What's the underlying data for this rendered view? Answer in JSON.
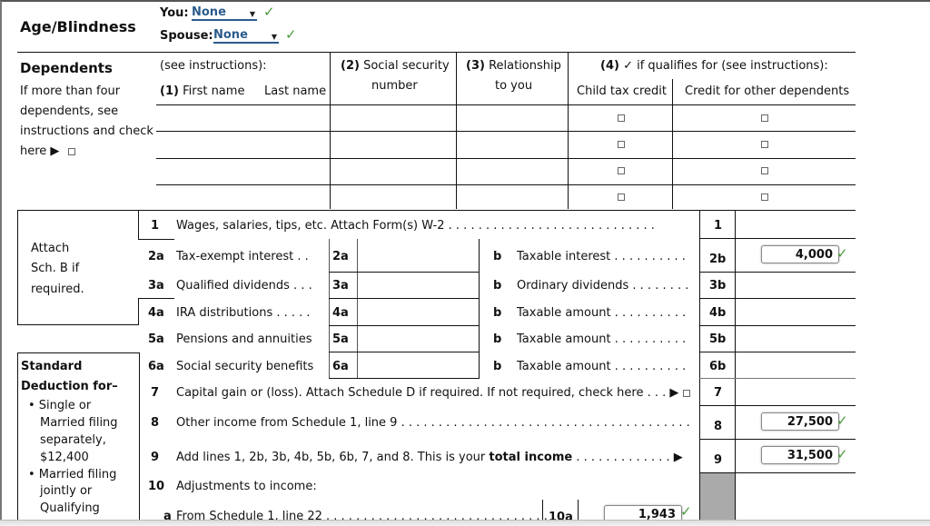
{
  "age_blindness": {
    "title": "Age/Blindness",
    "you_label": "You:",
    "you_value": "None",
    "spouse_label": "Spouse:",
    "spouse_value": "None"
  },
  "dependents": {
    "title": "Dependents",
    "note_lines": [
      "If more than four",
      "dependents, see",
      "instructions and check",
      "here ▶"
    ],
    "see_instructions": "(see instructions):",
    "col1_num": "(1)",
    "col1_first": "First name",
    "col1_last": "Last name",
    "col2_num": "(2)",
    "col2_line1": "Social security",
    "col2_line2": "number",
    "col3_num": "(3)",
    "col3_line1": "Relationship",
    "col3_line2": "to you",
    "col4_num": "(4)",
    "col4_text": "✓ if qualifies for (see instructions):",
    "col4a": "Child tax credit",
    "col4b": "Credit for other dependents",
    "rows": 4
  },
  "attach": {
    "lines": [
      "Attach",
      "Sch. B if",
      "required."
    ]
  },
  "std_deduction": {
    "title_line1": "Standard",
    "title_line2": "Deduction for–",
    "items": [
      "• Single or",
      "Married filing",
      "separately,",
      "$12,400",
      "• Married filing",
      "jointly or",
      "Qualifying"
    ]
  },
  "income_lines": {
    "line1": {
      "num": "1",
      "label": "Wages, salaries, tips, etc. Attach Form(s) W-2 . . . . . . . . . . . . . . . . . . . . . . . . . . . .",
      "box": "1",
      "value": ""
    },
    "line2": {
      "num": "2a",
      "label": "Tax-exempt interest . .",
      "box_a": "2a",
      "b": "b",
      "label_b": "Taxable interest . . . . . . . . . .",
      "box": "2b",
      "value": "4,000"
    },
    "line3": {
      "num": "3a",
      "label": "Qualified dividends . . .",
      "box_a": "3a",
      "b": "b",
      "label_b": "Ordinary dividends . . . . . . . .",
      "box": "3b",
      "value": ""
    },
    "line4": {
      "num": "4a",
      "label": "IRA distributions . . . . .",
      "box_a": "4a",
      "b": "b",
      "label_b": "Taxable amount . . . . . . . . . .",
      "box": "4b",
      "value": ""
    },
    "line5": {
      "num": "5a",
      "label": "Pensions and annuities",
      "box_a": "5a",
      "b": "b",
      "label_b": "Taxable amount . . . . . . . . . .",
      "box": "5b",
      "value": ""
    },
    "line6": {
      "num": "6a",
      "label": "Social security benefits",
      "box_a": "6a",
      "b": "b",
      "label_b": "Taxable amount . . . . . . . . . .",
      "box": "6b",
      "value": ""
    },
    "line7": {
      "num": "7",
      "label": "Capital gain or (loss). Attach Schedule D if required. If not required, check here . . . ▶",
      "box": "7",
      "value": ""
    },
    "line8": {
      "num": "8",
      "label": "Other income from Schedule 1, line 9 . . . . . . . . . . . . . . . . . . . . . . . . . . . . . . . . . . . . . . .",
      "box": "8",
      "value": "27,500"
    },
    "line9": {
      "num": "9",
      "label_pre": "Add lines 1, 2b, 3b, 4b, 5b, 6b, 7, and 8. This is your",
      "label_bold": "total income",
      "label_post": " . . . . . . . . . . . . . ▶",
      "box": "9",
      "value": "31,500"
    },
    "line10": {
      "num": "10",
      "label": "Adjustments to income:"
    },
    "line10a": {
      "num": "a",
      "label": "From Schedule 1, line 22 . . . . . . . . . . . . . . . . . . . . . . . . . . . . . . . .",
      "box": "10a",
      "value": "1,943"
    }
  }
}
